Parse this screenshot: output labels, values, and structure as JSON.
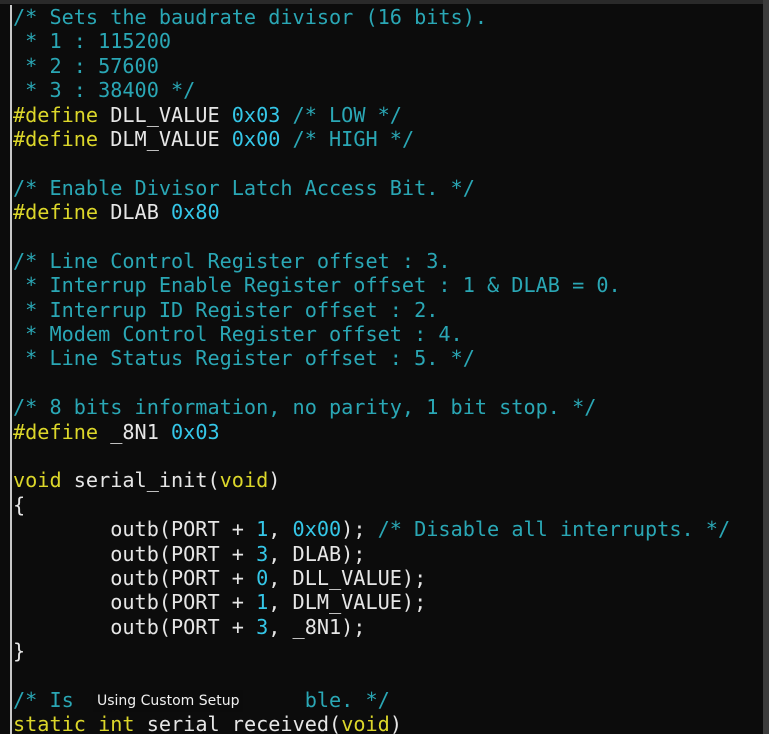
{
  "colors": {
    "background": "#0c0c0c",
    "comment": "#2aa7b5",
    "keyword": "#dcd72a",
    "number": "#35c7e8",
    "text": "#e6e6e6"
  },
  "overlay": {
    "label": "Using Custom Setup"
  },
  "code_lines": [
    [
      {
        "t": "comment",
        "v": "/* Sets the baudrate divisor (16 bits)."
      }
    ],
    [
      {
        "t": "comment",
        "v": " * 1 : 115200"
      }
    ],
    [
      {
        "t": "comment",
        "v": " * 2 : 57600"
      }
    ],
    [
      {
        "t": "comment",
        "v": " * 3 : 38400 */"
      }
    ],
    [
      {
        "t": "keyword",
        "v": "#define"
      },
      {
        "t": "plain",
        "v": " DLL_VALUE "
      },
      {
        "t": "number",
        "v": "0x03"
      },
      {
        "t": "comment",
        "v": " /* LOW */"
      }
    ],
    [
      {
        "t": "keyword",
        "v": "#define"
      },
      {
        "t": "plain",
        "v": " DLM_VALUE "
      },
      {
        "t": "number",
        "v": "0x00"
      },
      {
        "t": "comment",
        "v": " /* HIGH */"
      }
    ],
    [],
    [
      {
        "t": "comment",
        "v": "/* Enable Divisor Latch Access Bit. */"
      }
    ],
    [
      {
        "t": "keyword",
        "v": "#define"
      },
      {
        "t": "plain",
        "v": " DLAB "
      },
      {
        "t": "number",
        "v": "0x80"
      }
    ],
    [],
    [
      {
        "t": "comment",
        "v": "/* Line Control Register offset : 3."
      }
    ],
    [
      {
        "t": "comment",
        "v": " * Interrup Enable Register offset : 1 & DLAB = 0."
      }
    ],
    [
      {
        "t": "comment",
        "v": " * Interrup ID Register offset : 2."
      }
    ],
    [
      {
        "t": "comment",
        "v": " * Modem Control Register offset : 4."
      }
    ],
    [
      {
        "t": "comment",
        "v": " * Line Status Register offset : 5. */"
      }
    ],
    [],
    [
      {
        "t": "comment",
        "v": "/* 8 bits information, no parity, 1 bit stop. */"
      }
    ],
    [
      {
        "t": "keyword",
        "v": "#define"
      },
      {
        "t": "plain",
        "v": " _8N1 "
      },
      {
        "t": "number",
        "v": "0x03"
      }
    ],
    [],
    [
      {
        "t": "keyword",
        "v": "void"
      },
      {
        "t": "plain",
        "v": " serial_init("
      },
      {
        "t": "keyword",
        "v": "void"
      },
      {
        "t": "plain",
        "v": ")"
      }
    ],
    [
      {
        "t": "plain",
        "v": "{"
      }
    ],
    [
      {
        "t": "plain",
        "v": "        outb(PORT + "
      },
      {
        "t": "number",
        "v": "1"
      },
      {
        "t": "plain",
        "v": ", "
      },
      {
        "t": "number",
        "v": "0x00"
      },
      {
        "t": "plain",
        "v": "); "
      },
      {
        "t": "comment",
        "v": "/* Disable all interrupts. */"
      }
    ],
    [
      {
        "t": "plain",
        "v": "        outb(PORT + "
      },
      {
        "t": "number",
        "v": "3"
      },
      {
        "t": "plain",
        "v": ", DLAB);"
      }
    ],
    [
      {
        "t": "plain",
        "v": "        outb(PORT + "
      },
      {
        "t": "number",
        "v": "0"
      },
      {
        "t": "plain",
        "v": ", DLL_VALUE);"
      }
    ],
    [
      {
        "t": "plain",
        "v": "        outb(PORT + "
      },
      {
        "t": "number",
        "v": "1"
      },
      {
        "t": "plain",
        "v": ", DLM_VALUE);"
      }
    ],
    [
      {
        "t": "plain",
        "v": "        outb(PORT + "
      },
      {
        "t": "number",
        "v": "3"
      },
      {
        "t": "plain",
        "v": ", _8N1);"
      }
    ],
    [
      {
        "t": "plain",
        "v": "}"
      }
    ],
    [],
    [
      {
        "t": "comment",
        "v": "/* Is "
      },
      {
        "t": "comment",
        "v": "                  "
      },
      {
        "t": "comment",
        "v": "ble. */"
      }
    ],
    [
      {
        "t": "keyword",
        "v": "static"
      },
      {
        "t": "plain",
        "v": " "
      },
      {
        "t": "keyword",
        "v": "int"
      },
      {
        "t": "plain",
        "v": " serial_received("
      },
      {
        "t": "keyword",
        "v": "void"
      },
      {
        "t": "plain",
        "v": ")"
      }
    ]
  ]
}
